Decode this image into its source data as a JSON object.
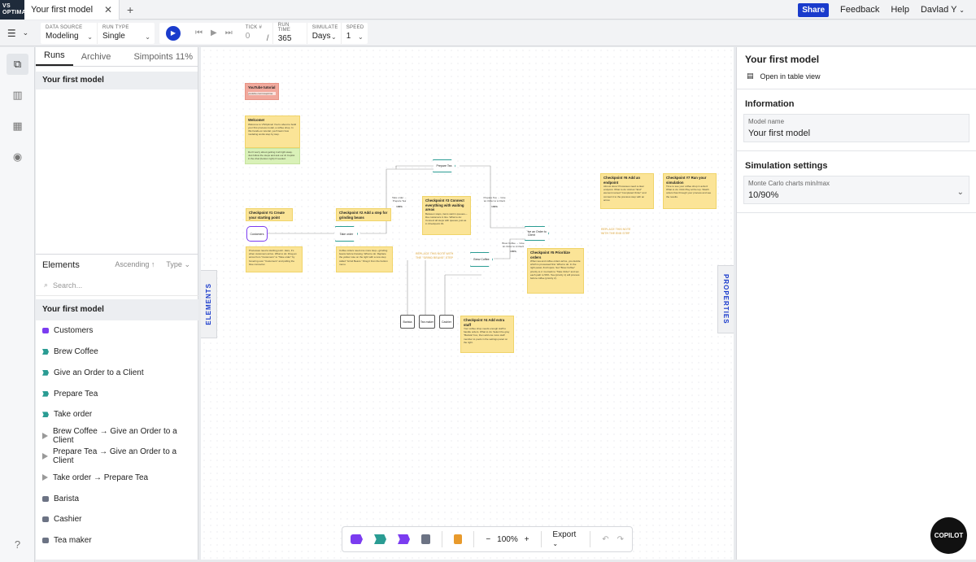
{
  "app": {
    "logo": "VS OPTIMA"
  },
  "tabs": [
    {
      "label": "Your first model"
    }
  ],
  "topbar": {
    "share": "Share",
    "feedback": "Feedback",
    "help": "Help",
    "user": "Davlad Y"
  },
  "toolbar": {
    "data_source": {
      "label": "DATA SOURCE",
      "value": "Modeling"
    },
    "run_type": {
      "label": "RUN TYPE",
      "value": "Single"
    },
    "tick": {
      "label": "TICK #",
      "value": "0"
    },
    "run_time": {
      "label": "RUN TIME",
      "separator": "/",
      "value": "365"
    },
    "simulate": {
      "label": "SIMULATE",
      "value": "Days"
    },
    "speed": {
      "label": "SPEED",
      "value": "1"
    }
  },
  "left_panel": {
    "tabs": [
      "Runs",
      "Archive"
    ],
    "simpoints": "Simpoints 11%",
    "run_item": "Your first model",
    "elements_title": "Elements",
    "sort_label": "Ascending",
    "type_label": "Type",
    "search_placeholder": "Search...",
    "items": [
      {
        "label": "Your first model",
        "kind": "head"
      },
      {
        "label": "Customers",
        "kind": "purple"
      },
      {
        "label": "Brew Coffee",
        "kind": "teal"
      },
      {
        "label": "Give an Order to a Client",
        "kind": "teal"
      },
      {
        "label": "Prepare Tea",
        "kind": "teal"
      },
      {
        "label": "Take order",
        "kind": "teal"
      },
      {
        "label": "Brew Coffee → Give an Order to a Client",
        "kind": "arrow"
      },
      {
        "label": "Prepare Tea → Give an Order to a Client",
        "kind": "arrow"
      },
      {
        "label": "Take order → Prepare Tea",
        "kind": "arrow"
      },
      {
        "label": "Barista",
        "kind": "gray"
      },
      {
        "label": "Cashier",
        "kind": "gray"
      },
      {
        "label": "Tea maker",
        "kind": "gray"
      }
    ]
  },
  "canvas": {
    "elements_tab": "ELEMENTS",
    "properties_tab": "PROPERTIES",
    "notes": {
      "youtube": {
        "title": "YouTube tutorial",
        "body": "youtube.com/vsoptima"
      },
      "welcome": {
        "title": "Welcome!",
        "body": "Welcome to VSOptima! You're about to build your first process model, a coffee shop. In this hands-on tutorial, you'll learn how modeling works step by step."
      },
      "welcome_green": {
        "body": "Don't worry about getting it all right away. Just follow the steps and ask our AI Copilot in the chat (bottom right) if needed."
      },
      "cp1": {
        "title": "Checkpoint #1 Create your starting point",
        "body": "Processes need a starting point. Here, it's when customers arrive. What to do: Drag an arrow from \"Customers\" to \"Take order\" by hovering over \"Customers\" and pulling the blue connector."
      },
      "cp2": {
        "title": "Checkpoint #2 Add a step for grinding beans",
        "body": "Coffee orders need one more step—grinding beans before brewing. What to do: Replace the yellow note on the right with a new step called \"Grind Beans.\" Drag it from the bottom menu."
      },
      "cp3": {
        "title": "Checkpoint #3 Connect everything with waiting areas",
        "body": "Between steps, items wait in queues—like customers in line. What to do: Connect all steps with queues, just as in Checkpoint #1."
      },
      "cp4": {
        "title": "Checkpoint #4 Add extra staff",
        "body": "Your coffee shop needs enough staff to handle orders. What to do: Select the gray \"Barista\" box, then add one more staff member to pools in the settings panel on the right."
      },
      "cp5": {
        "title": "Checkpoint #5 Prioritize orders",
        "body": "When tea and coffee orders arrive, you decide which is processed first. What to do: In the right panel, find Inputs. Set \"Brew Coffee\" priority to 2. Go back to \"Take Order\" and set each path to 50%. Tea (priority 1) will process before coffee (priority 2)."
      },
      "cp6": {
        "title": "Checkpoint #6 Add an endpoint",
        "body": "Almost done! Processes need a clear endpoint. What to do: Add an \"End\" element named \"Completed Order\" and connect it to the previous step with an arrow."
      },
      "cp7": {
        "title": "Checkpoint #7 Run your simulation",
        "body": "Time to see your coffee shop in action! What to do: Click Play at the top. Watch orders flow through your process and see the results."
      }
    },
    "ghosts": {
      "g1": "REPLACE THIS NOTE WITH THE \"GRIND BEANS\" STEP",
      "g2": "REPLACE THIS NOTE WITH THE END STEP"
    },
    "nodes": {
      "prepare_tea": "Prepare Tea",
      "customers": "Customers",
      "take_order": "Take order",
      "give_order": "Give an Order to a Client",
      "brew_coffee": "Brew Coffee",
      "barista": "Barista",
      "tea_maker": "Tea maker",
      "cashier": "Cashier"
    },
    "flow_labels": {
      "f1": "Take order → Prepare Tea",
      "f1p": "100%",
      "f2": "Prepare Tea → Give an Order to a Client",
      "f2p": "100%",
      "f3": "Brew Coffee → Give an Order to a Client",
      "f3p": "100%"
    }
  },
  "canvas_toolbar": {
    "zoom": "100%",
    "zoom_minus": "−",
    "zoom_plus": "+",
    "export": "Export"
  },
  "right_panel": {
    "title": "Your first model",
    "table_view": "Open in table view",
    "information": "Information",
    "model_name_label": "Model name",
    "model_name_value": "Your first model",
    "sim_settings": "Simulation settings",
    "mc_label": "Monte Carlo charts min/max",
    "mc_value": "10/90%"
  },
  "copilot": "COPILOT"
}
